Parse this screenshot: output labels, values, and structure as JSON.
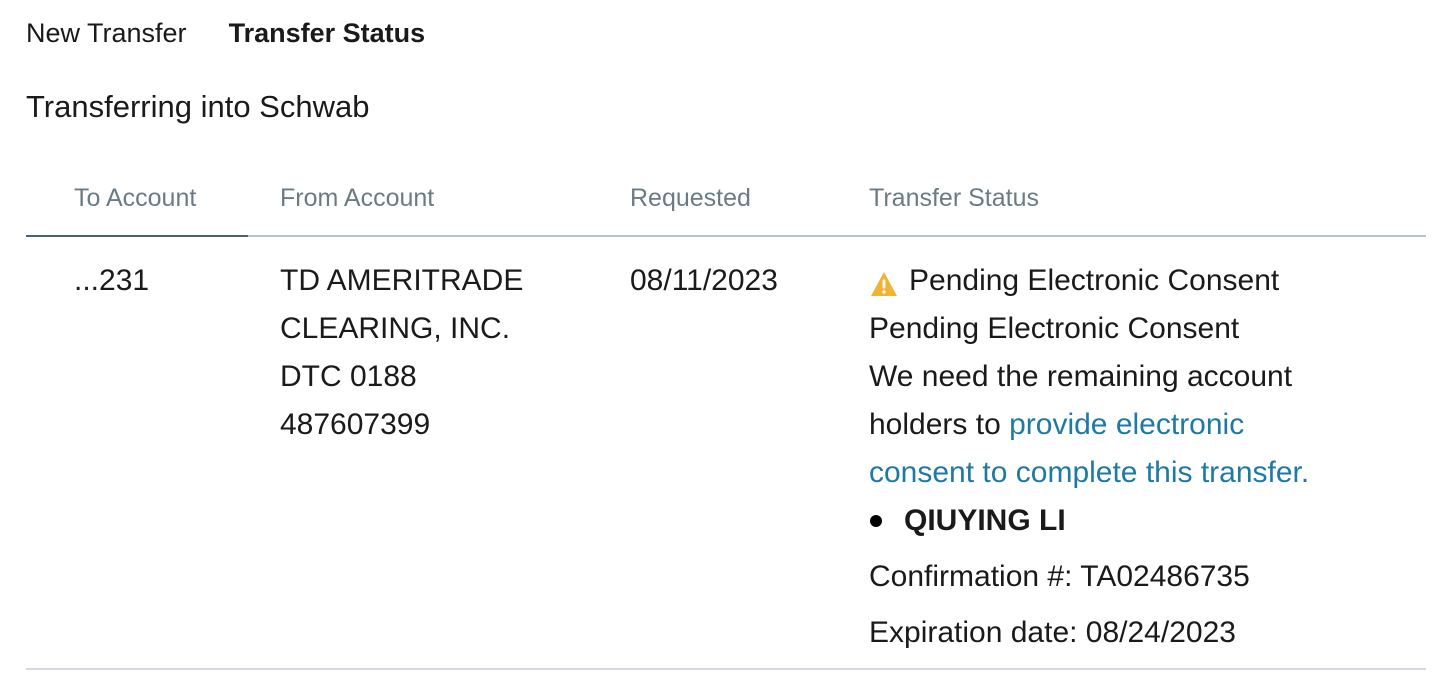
{
  "tabs": {
    "new_transfer": "New Transfer",
    "transfer_status": "Transfer Status"
  },
  "section": {
    "title": "Transferring into Schwab"
  },
  "table": {
    "headers": {
      "to_account": "To Account",
      "from_account": "From Account",
      "requested": "Requested",
      "transfer_status": "Transfer Status"
    },
    "rows": [
      {
        "to_account": "...231",
        "from_account_lines": [
          "TD AMERITRADE",
          "CLEARING, INC.",
          "DTC 0188",
          "487607399"
        ],
        "requested": "08/11/2023",
        "status": {
          "icon": "warning-icon",
          "headline": "Pending Electronic Consent",
          "subheadline": "Pending Electronic Consent",
          "message_line1": "We need the remaining account",
          "message_line2_prefix": "holders to ",
          "link_line1": "provide electronic",
          "link_line2": "consent to complete this transfer.",
          "holders": [
            "QIUYING LI"
          ],
          "confirmation": "Confirmation #: TA02486735",
          "expiration": "Expiration date: 08/24/2023"
        }
      }
    ]
  },
  "colors": {
    "accent_link": "#1f7aa3",
    "warning": "#f2b233",
    "header_text": "#6b7b86",
    "divider": "#b7c2cc"
  }
}
